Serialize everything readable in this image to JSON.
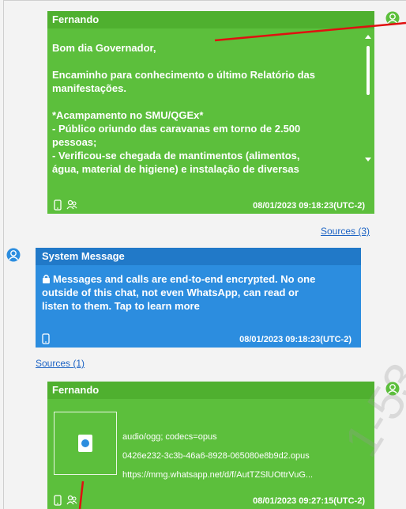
{
  "messages": [
    {
      "sender": "Fernando",
      "text_lines": [
        "Bom dia Governador,",
        "",
        "Encaminho para conhecimento o último Relatório das",
        "manifestações.",
        "",
        "*Acampamento no SMU/QGEx*",
        "- Público oriundo das caravanas em torno de 2.500",
        "pessoas;",
        "- Verificou-se chegada de mantimentos (alimentos,",
        "água, material de higiene) e instalação de diversas"
      ],
      "timestamp": "08/01/2023 09:18:23(UTC-2)",
      "sources_label": "Sources (3)"
    },
    {
      "sender": "System Message",
      "text_lines": [
        "Messages and calls are end-to-end encrypted. No one",
        "outside of this chat, not even WhatsApp, can read or",
        "listen to them. Tap to learn more"
      ],
      "timestamp": "08/01/2023 09:18:23(UTC-2)",
      "sources_label": "Sources (1)"
    },
    {
      "sender": "Fernando",
      "attachment": {
        "mime": "audio/ogg; codecs=opus",
        "filename": "0426e232-3c3b-46a6-8928-065080e8b9d2.opus",
        "url": "https://mmg.whatsapp.net/d/f/AutTZSlUOttrVuG..."
      },
      "timestamp": "08/01/2023 09:27:15(UTC-2)"
    }
  ],
  "watermark": "1-53",
  "colors": {
    "green": "#5cbf3c",
    "blue": "#2c8ddf",
    "link": "#1c63c4",
    "annotation": "#e01010"
  }
}
